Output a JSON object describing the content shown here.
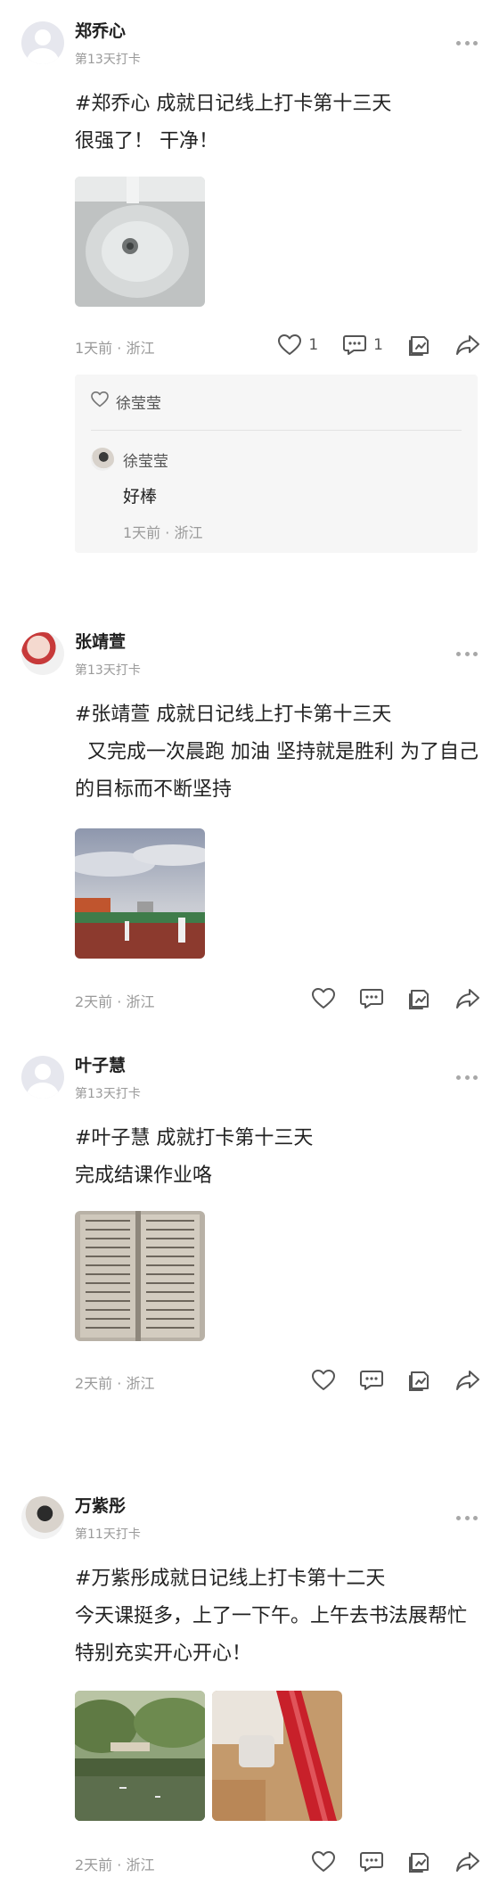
{
  "posts": [
    {
      "author": "郑乔心",
      "checkin": "第13天打卡",
      "text": "#郑乔心 成就日记线上打卡第十三天\n很强了！ 干净！",
      "time_location": "1天前 · 浙江",
      "like_count": "1",
      "comment_count": "1",
      "likes_box": {
        "liker": "徐莹莹",
        "comment": {
          "author": "徐莹莹",
          "text": "好棒",
          "time_location": "1天前 · 浙江"
        }
      }
    },
    {
      "author": "张靖萱",
      "checkin": "第13天打卡",
      "text": "#张靖萱 成就日记线上打卡第十三天\n  又完成一次晨跑 加油 坚持就是胜利 为了自己的目标而不断坚持",
      "time_location": "2天前 · 浙江"
    },
    {
      "author": "叶子慧",
      "checkin": "第13天打卡",
      "text": "#叶子慧 成就打卡第十三天\n完成结课作业咯",
      "time_location": "2天前 · 浙江"
    },
    {
      "author": "万紫彤",
      "checkin": "第11天打卡",
      "text": "#万紫彤成就日记线上打卡第十二天\n今天课挺多，上了一下午。上午去书法展帮忙特别充实开心开心！",
      "time_location": "2天前 · 浙江"
    }
  ],
  "icons": {
    "more": "more-dots-icon",
    "like": "heart-icon",
    "comment": "comment-icon",
    "collect": "collect-icon",
    "share": "share-icon"
  },
  "colors": {
    "text": "#222222",
    "muted": "#9a9a9a",
    "box_bg": "#f6f6f6"
  }
}
